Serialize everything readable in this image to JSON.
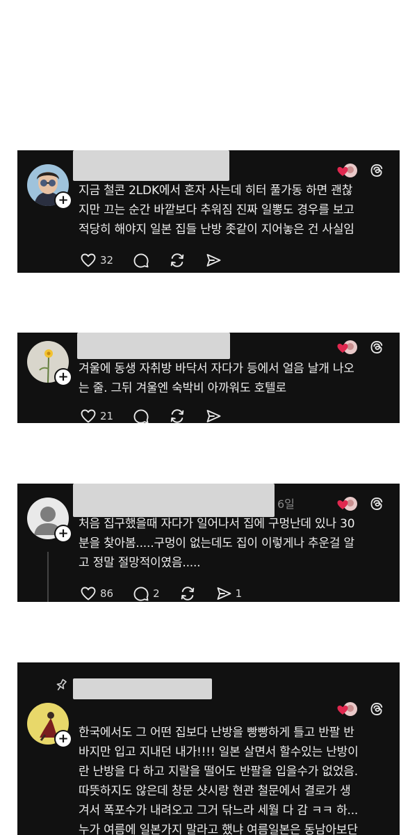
{
  "posts": [
    {
      "text": "지금 철콘 2LDK에서 혼자 사는데 히터 풀가동 하면 괜찮\n지만 끄는 순간 바깥보다 추워짐 진짜 일뽕도 경우를 보고\n적당히 해야지 일본 집들 난방 좃같이 지어놓은 건 사실임",
      "likes": "32",
      "replies": "",
      "reposts": "",
      "shares": "",
      "time": ""
    },
    {
      "text": "겨울에 동생 자취방 바닥서 자다가 등에서 얼음 날개 나오\n는 줄. 그뒤 겨울엔 숙박비 아까워도 호텔로",
      "likes": "21",
      "replies": "",
      "reposts": "",
      "shares": "",
      "time": ""
    },
    {
      "text": "처음 집구했을때 자다가 일어나서 집에 구멍난데 있나 30\n분을 찾아봄.....구멍이 없는데도 집이 이렇게나 추운걸 알\n고 정말 절망적이였음.....",
      "likes": "86",
      "replies": "2",
      "reposts": "",
      "shares": "1",
      "time": "6일"
    },
    {
      "text": "한국에서도 그 어떤 집보다 난방을 빵빵하게 틀고 반팔 반\n바지만 입고 지내던 내가!!!! 일본 살면서 할수있는 난방이\n란 난방을 다 하고 지랄을 떨어도 반팔을 입을수가 없었음.\n따뜻하지도 않은데 창문 샷시랑 현관 철문에서 결로가 생\n겨서 폭포수가 내려오고 그거 닦느라 세월 다 감 ㅋㅋ 하...\n누가 여름에 일본가지 말라고 했냐 여름일본은 동남아보단",
      "likes": "",
      "replies": "",
      "reposts": "",
      "shares": "",
      "time": ""
    }
  ],
  "icons": {
    "like": "heart-outline-icon",
    "reply": "speech-bubble-icon",
    "repost": "repost-arrows-icon",
    "share": "send-paper-plane-icon",
    "platform": "threads-logo-icon",
    "liked_badge": "red-heart-avatar-badge",
    "pin": "pin-icon"
  },
  "colors": {
    "card_bg": "#111111",
    "text": "#efefef",
    "redaction": "#d6d6d6",
    "heart": "#e0284f"
  }
}
